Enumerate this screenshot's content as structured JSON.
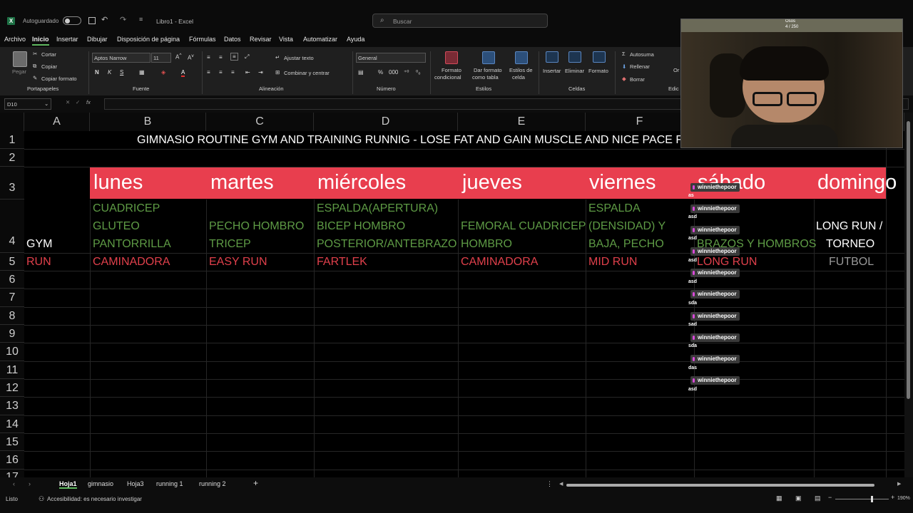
{
  "titlebar": {
    "autosave_label": "Autoguardado",
    "file_title": "Libro1  -  Excel",
    "search_placeholder": "Buscar"
  },
  "menu": [
    "Archivo",
    "Inicio",
    "Insertar",
    "Dibujar",
    "Disposición de página",
    "Fórmulas",
    "Datos",
    "Revisar",
    "Vista",
    "Automatizar",
    "Ayuda"
  ],
  "ribbon": {
    "paste": "Pegar",
    "cut": "Cortar",
    "copy": "Copiar",
    "format_painter": "Copiar formato",
    "clipboard_group": "Portapapeles",
    "font_name": "Aptos Narrow",
    "font_size": "11",
    "font_group": "Fuente",
    "wrap_text": "Ajustar texto",
    "merge_center": "Combinar y centrar",
    "alignment_group": "Alineación",
    "number_format": "General",
    "number_group": "Número",
    "cond_format": [
      "Formato",
      "condicional"
    ],
    "format_table": [
      "Dar formato",
      "como tabla"
    ],
    "cell_styles": [
      "Estilos de",
      "celda"
    ],
    "styles_group": "Estilos",
    "insert": "Insertar",
    "delete": "Eliminar",
    "format": "Formato",
    "cells_group": "Celdas",
    "autosum": "Autosuma",
    "fill": "Rellenar",
    "clear": "Borrar",
    "edit_group": "Edic",
    "order_partial": "Or"
  },
  "formula_bar": {
    "name_box": "D10",
    "formula": ""
  },
  "sheet": {
    "columns": [
      "A",
      "B",
      "C",
      "D",
      "E",
      "F"
    ],
    "rows": [
      "1",
      "2",
      "3",
      "4",
      "5",
      "6",
      "7",
      "8",
      "9",
      "10",
      "11",
      "12",
      "13",
      "14",
      "15",
      "16",
      "17"
    ],
    "title": "GIMNASIO ROUTINE GYM AND TRAINING RUNNIG - LOSE FAT AND GAIN MUSCLE AND NICE PACE FOR",
    "days": [
      "lunes",
      "martes",
      "miércoles",
      "jueves",
      "viernes",
      "sábado",
      "domingo"
    ],
    "gym_label": "GYM",
    "run_label": "RUN",
    "gym": {
      "lunes": [
        "CUADRICEP",
        "GLUTEO",
        "PANTORRILLA"
      ],
      "martes": [
        "PECHO HOMBRO",
        "TRICEP"
      ],
      "miercoles": [
        "ESPALDA(APERTURA)",
        "BICEP HOMBRO",
        "POSTERIOR/ANTEBRAZO"
      ],
      "jueves": [
        "FEMORAL CUADRICEP",
        "HOMBRO"
      ],
      "viernes": [
        "ESPALDA",
        "(DENSIDAD) Y",
        "BAJA, PECHO"
      ],
      "sabado": "BRAZOS Y HOMBROS",
      "domingo": [
        "LONG RUN /",
        "TORNEO",
        "FUTBOL"
      ]
    },
    "run": {
      "lunes": "CAMINADORA",
      "martes": "EASY RUN",
      "miercoles": "FARTLEK",
      "jueves": "CAMINADORA",
      "viernes": "MID RUN",
      "sabado": "LONG RUN"
    }
  },
  "tabs": [
    "Hoja1",
    "gimnasio",
    "Hoja3",
    "running 1",
    "running 2"
  ],
  "status": {
    "ready": "Listo",
    "accessibility": "Accesibilidad: es necesario investigar",
    "zoom": "190%"
  },
  "webcam": {
    "name": "Osos",
    "count": "4 / 250"
  },
  "chat": [
    {
      "user": "winniethepoor",
      "msg": "as"
    },
    {
      "user": "winniethepoor",
      "msg": "asd"
    },
    {
      "user": "winniethepoor",
      "msg": "asd"
    },
    {
      "user": "winniethepoor",
      "msg": "asd"
    },
    {
      "user": "winniethepoor",
      "msg": "asd"
    },
    {
      "user": "winniethepoor",
      "msg": "sda"
    },
    {
      "user": "winniethepoor",
      "msg": "sad"
    },
    {
      "user": "winniethepoor",
      "msg": "sda"
    },
    {
      "user": "winniethepoor",
      "msg": "das"
    },
    {
      "user": "winniethepoor",
      "msg": "asd"
    }
  ],
  "colors": {
    "accent_red": "#e0404b",
    "day_band": "#e83e4e",
    "green_text": "#5e9b45",
    "excel_green": "#1e7145"
  }
}
